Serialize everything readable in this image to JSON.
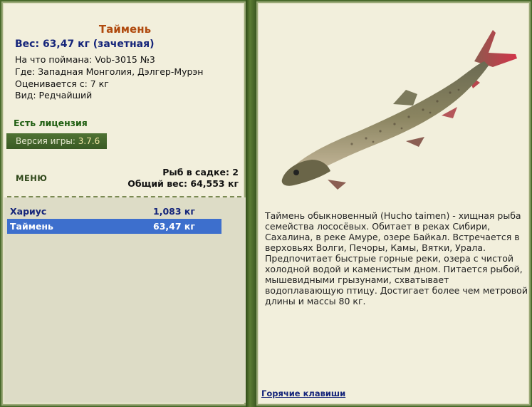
{
  "fish": {
    "title": "Таймень",
    "weight": "Вес: 63,47 кг (зачетная)",
    "caught_with": "На что поймана: Vob-3015 №3",
    "where": "Где: Западная Монголия, Дэлгер-Мурэн",
    "counted_from": "Оценивается с: 7 кг",
    "kind": "Вид: Редчайший"
  },
  "license": "Есть лицензия",
  "version": {
    "label": "Версия игры: ",
    "value": "3.7.6"
  },
  "menu_label": "МЕНЮ",
  "stats": {
    "fish_in_keepnet": "Рыб в садке: 2",
    "total_weight": "Общий вес: 64,553 кг"
  },
  "catch_list": [
    {
      "name": "Хариус",
      "weight": "1,083 кг",
      "selected": false
    },
    {
      "name": "Таймень",
      "weight": "63,47 кг",
      "selected": true
    }
  ],
  "description": "Таймень обыкновенный (Hucho taimen) - хищная рыба семейства лососёвых. Обитает в реках Сибири, Сахалина, в реке Амуре, озере Байкал. Встречается в верховьях Волги, Печоры, Камы, Вятки, Урала. Предпочитает быстрые горные реки, озера с чистой холодной водой и каменистым дном. Питается рыбой, мышевидными грызунами, схватывает водоплавающую птицу. Достигает более чем метровой длины и массы 80 кг.",
  "hotkeys_label": "Горячие клавиши",
  "colors": {
    "panel_bg": "#f2efdc",
    "frame_green": "#4a6b2c",
    "title_orange": "#b04a0e",
    "weight_blue": "#15257a",
    "selection_blue": "#3d6fcd"
  }
}
